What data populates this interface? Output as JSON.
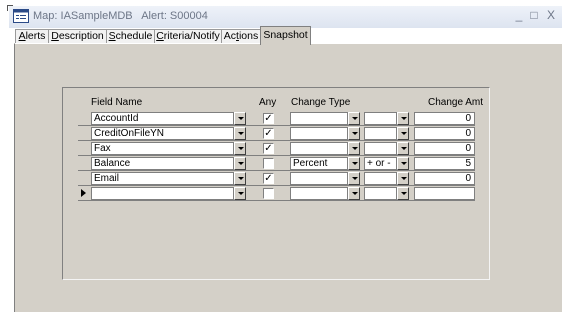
{
  "window": {
    "title": "Map: IASampleMDB   Alert: S00004",
    "minimize": "_",
    "restore": "□",
    "close": "X"
  },
  "tabs": [
    {
      "pre": "",
      "key": "A",
      "post": "lerts"
    },
    {
      "pre": "",
      "key": "D",
      "post": "escription"
    },
    {
      "pre": "",
      "key": "S",
      "post": "chedule"
    },
    {
      "pre": "",
      "key": "C",
      "post": "riteria/Notify"
    },
    {
      "pre": "Ac",
      "key": "t",
      "post": "ions"
    },
    {
      "pre": "Snapshot",
      "key": "",
      "post": ""
    }
  ],
  "active_tab": "Snapshot",
  "columns": {
    "field_name": "Field Name",
    "any": "Any",
    "change_type": "Change Type",
    "change_amt": "Change Amt"
  },
  "rows": [
    {
      "field": "AccountId",
      "any": true,
      "change_type": "",
      "operator": "",
      "amount": "0"
    },
    {
      "field": "CreditOnFileYN",
      "any": true,
      "change_type": "",
      "operator": "",
      "amount": "0"
    },
    {
      "field": "Fax",
      "any": true,
      "change_type": "",
      "operator": "",
      "amount": "0"
    },
    {
      "field": "Balance",
      "any": false,
      "change_type": "Percent",
      "operator": "+ or -",
      "amount": "5"
    },
    {
      "field": "Email",
      "any": true,
      "change_type": "",
      "operator": "",
      "amount": "0"
    },
    {
      "field": "",
      "any": false,
      "change_type": "",
      "operator": "",
      "amount": ""
    }
  ],
  "check_glyph": "✓"
}
